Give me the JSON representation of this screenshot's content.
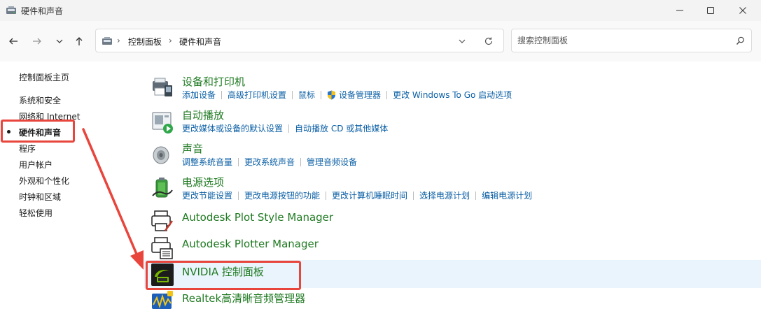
{
  "window": {
    "title": "硬件和声音",
    "controls": {
      "minimize": "minimize",
      "maximize": "maximize",
      "close": "close"
    }
  },
  "address": {
    "crumbs": [
      "控制面板",
      "硬件和声音"
    ]
  },
  "search": {
    "placeholder": "搜索控制面板"
  },
  "sidebar": {
    "items": [
      {
        "label": "控制面板主页"
      },
      {
        "label": "系统和安全"
      },
      {
        "label": "网络和 Internet"
      },
      {
        "label": "硬件和声音",
        "current": true
      },
      {
        "label": "程序"
      },
      {
        "label": "用户帐户"
      },
      {
        "label": "外观和个性化"
      },
      {
        "label": "时钟和区域"
      },
      {
        "label": "轻松使用"
      }
    ]
  },
  "categories": [
    {
      "title": "设备和打印机",
      "icon": "printer-devices-icon",
      "links": [
        "添加设备",
        "高级打印机设置",
        "鼠标",
        "设备管理器",
        "更改 Windows To Go 启动选项"
      ]
    },
    {
      "title": "自动播放",
      "icon": "autoplay-icon",
      "links": [
        "更改媒体或设备的默认设置",
        "自动播放 CD 或其他媒体"
      ]
    },
    {
      "title": "声音",
      "icon": "speaker-icon",
      "links": [
        "调整系统音量",
        "更改系统声音",
        "管理音频设备"
      ]
    },
    {
      "title": "电源选项",
      "icon": "battery-icon",
      "links": [
        "更改节能设置",
        "更改电源按钮的功能",
        "更改计算机睡眠时间",
        "选择电源计划",
        "编辑电源计划"
      ]
    },
    {
      "title": "Autodesk Plot Style Manager",
      "icon": "plot-style-icon",
      "links": []
    },
    {
      "title": "Autodesk Plotter Manager",
      "icon": "plotter-icon",
      "links": []
    },
    {
      "title": "NVIDIA 控制面板",
      "icon": "nvidia-icon",
      "links": []
    },
    {
      "title": "Realtek高清晰音频管理器",
      "icon": "realtek-icon",
      "links": []
    }
  ],
  "colors": {
    "category_title": "#1f7a21",
    "link": "#0b5fa5",
    "annotation_red": "#e8453c",
    "hover_row": "#eaf4fc"
  }
}
